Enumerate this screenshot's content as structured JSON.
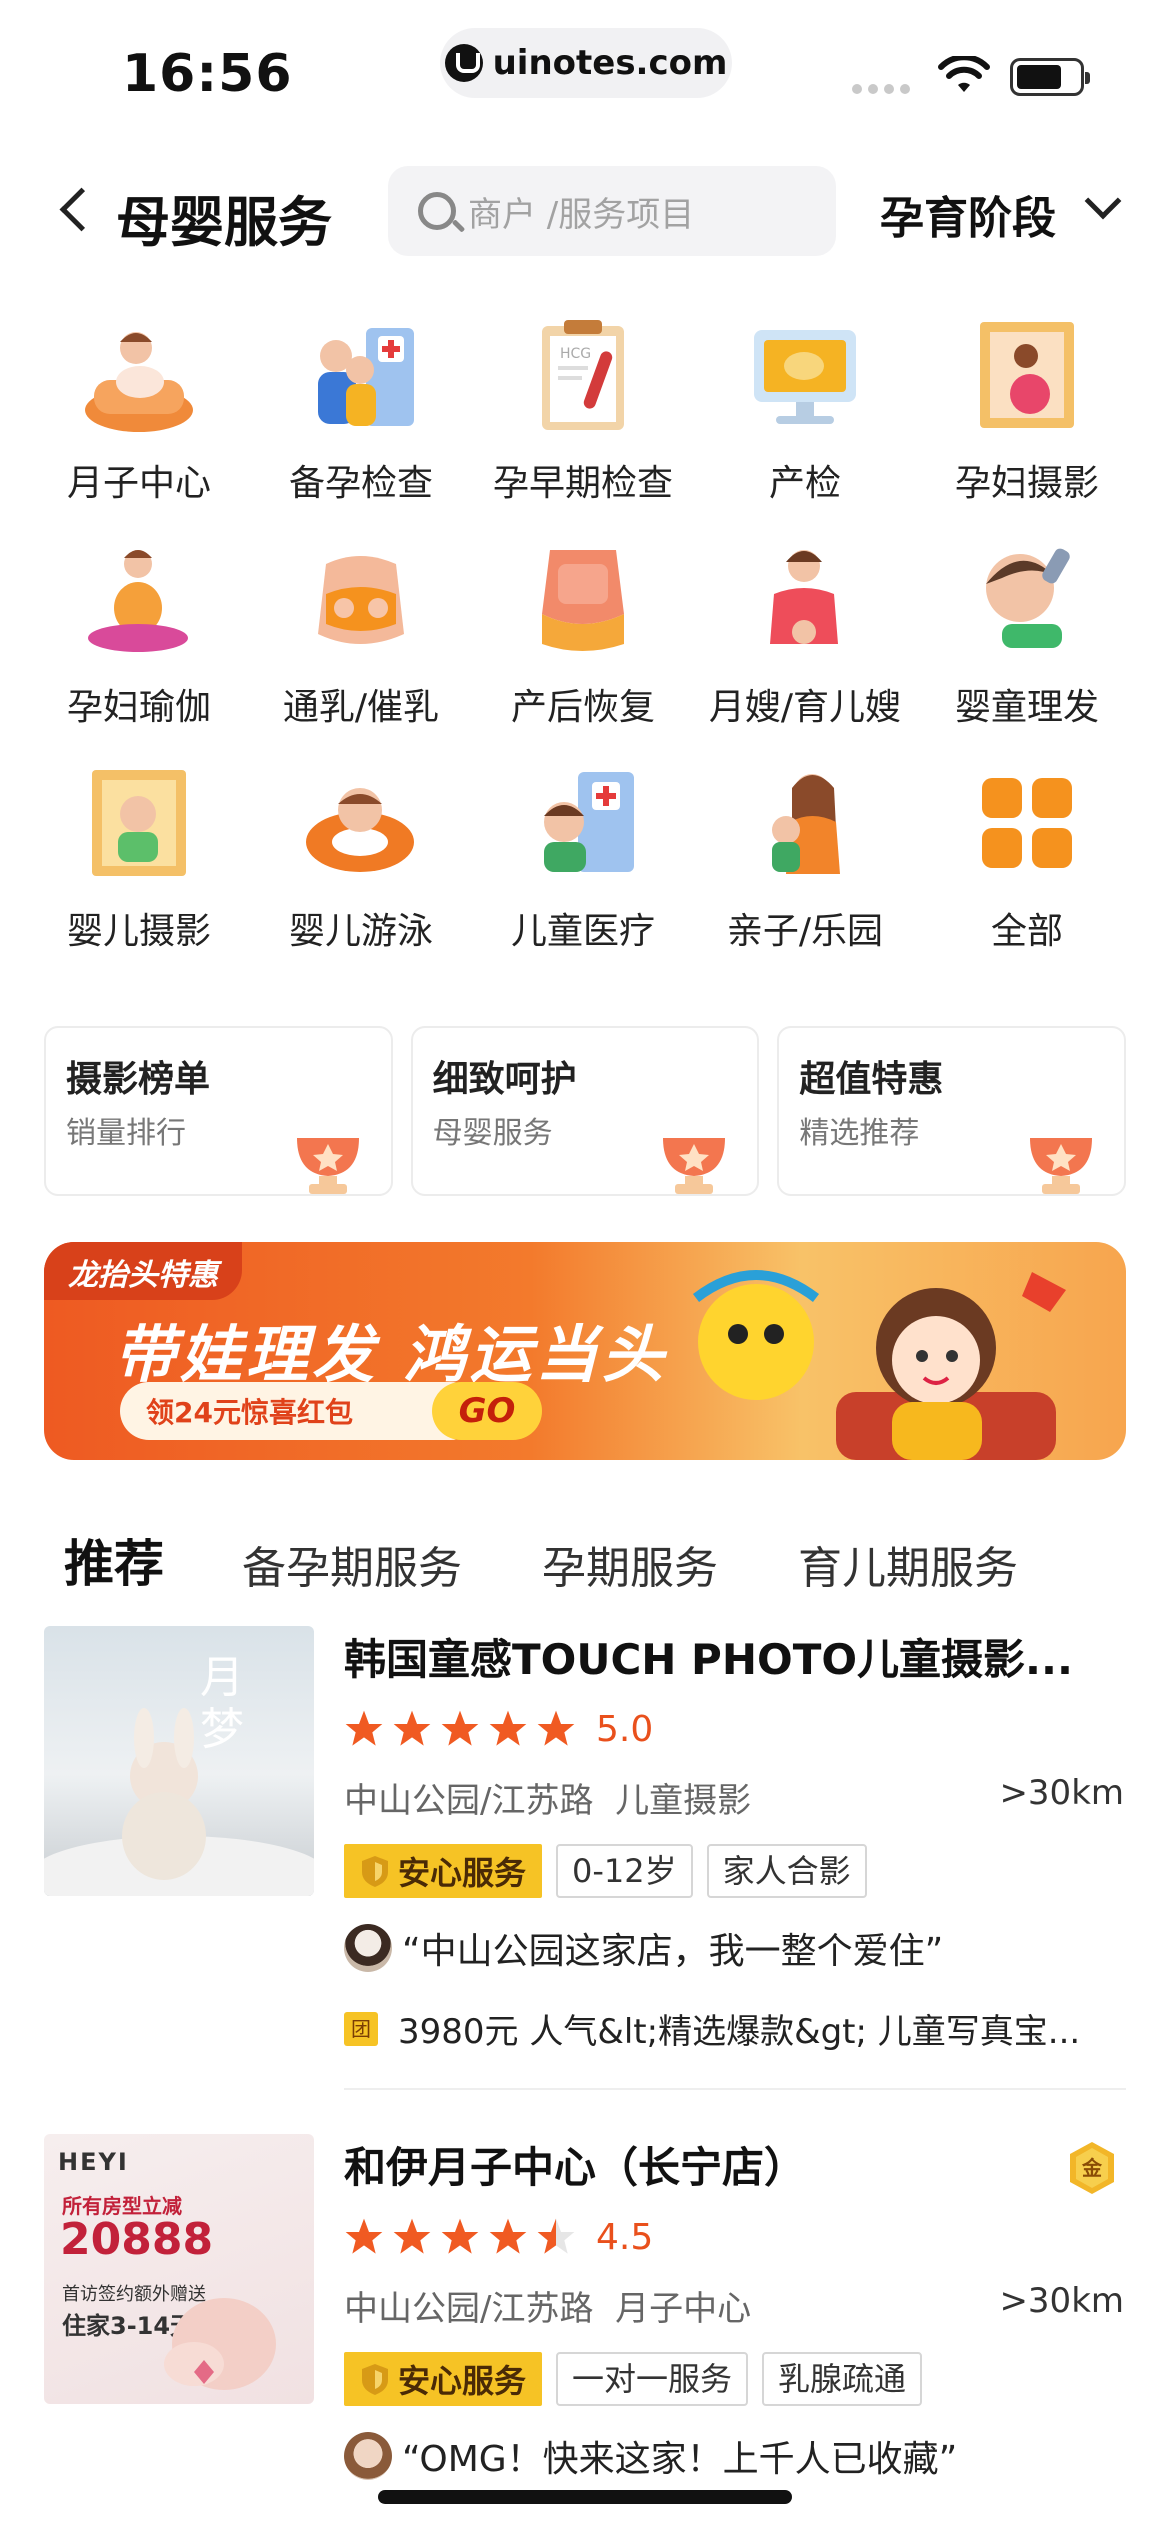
{
  "status_bar": {
    "time": "16:56",
    "url": "uinotes.com"
  },
  "nav": {
    "title": "母婴服务",
    "search_placeholder": "商户 /服务项目",
    "stage_label": "孕育阶段"
  },
  "categories": [
    {
      "label": "月子中心",
      "icon": "confinement-center-icon"
    },
    {
      "label": "备孕检查",
      "icon": "pre-pregnancy-check-icon"
    },
    {
      "label": "孕早期检查",
      "icon": "early-pregnancy-check-icon"
    },
    {
      "label": "产检",
      "icon": "prenatal-check-icon"
    },
    {
      "label": "孕妇摄影",
      "icon": "maternity-photo-icon"
    },
    {
      "label": "孕妇瑜伽",
      "icon": "prenatal-yoga-icon"
    },
    {
      "label": "通乳/催乳",
      "icon": "lactation-icon"
    },
    {
      "label": "产后恢复",
      "icon": "postpartum-recovery-icon"
    },
    {
      "label": "月嫂/育儿嫂",
      "icon": "nanny-icon"
    },
    {
      "label": "婴童理发",
      "icon": "baby-haircut-icon"
    },
    {
      "label": "婴儿摄影",
      "icon": "baby-photo-icon"
    },
    {
      "label": "婴儿游泳",
      "icon": "baby-swim-icon"
    },
    {
      "label": "儿童医疗",
      "icon": "child-medical-icon"
    },
    {
      "label": "亲子/乐园",
      "icon": "family-park-icon"
    },
    {
      "label": "全部",
      "icon": "all-grid-icon"
    }
  ],
  "quick_cards": [
    {
      "title": "摄影榜单",
      "subtitle": "销量排行"
    },
    {
      "title": "细致呵护",
      "subtitle": "母婴服务"
    },
    {
      "title": "超值特惠",
      "subtitle": "精选推荐"
    }
  ],
  "banner": {
    "tag": "龙抬头特惠",
    "headline": "带娃理发 鸿运当头",
    "coupon": "领24元惊喜红包",
    "cta": "GO"
  },
  "tabs": [
    "推荐",
    "备孕期服务",
    "孕期服务",
    "育儿期服务"
  ],
  "listings": [
    {
      "title": "韩国童感TOUCH PHOTO儿童摄影...",
      "rating": 5.0,
      "rating_text": "5.0",
      "location": "中山公园/江苏路",
      "category": "儿童摄影",
      "distance": ">30km",
      "safe_badge": "安心服务",
      "tags": [
        "0-12岁",
        "家人合影"
      ],
      "review": "“中山公园这家店，我一整个爱住”",
      "deal_badge": "团",
      "deal": "3980元 人气&lt;精选爆款&gt; 儿童写真宝...",
      "thumb_text": "月梦"
    },
    {
      "title": "和伊月子中心（长宁店）",
      "rating": 4.5,
      "rating_text": "4.5",
      "location": "中山公园/江苏路",
      "category": "月子中心",
      "distance": ">30km",
      "safe_badge": "安心服务",
      "tags": [
        "一对一服务",
        "乳腺疏通"
      ],
      "review": "“OMG！快来这家！上千人已收藏”",
      "gold_badge": "金",
      "thumb_brand": "HEYI",
      "thumb_line1": "所有房型立减",
      "thumb_price": "20888",
      "thumb_line2": "首访签约额外赠送",
      "thumb_line3": "住家3-14天"
    }
  ],
  "colors": {
    "accent_orange": "#e9501c",
    "gold": "#f6c325",
    "tab_highlight": "#ffd84a"
  }
}
